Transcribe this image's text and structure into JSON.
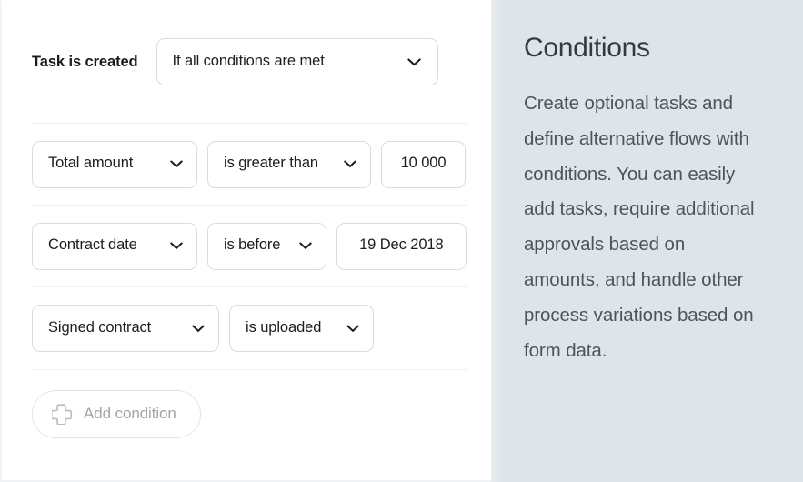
{
  "left_panel": {
    "trigger": {
      "label": "Task is created",
      "mode_select": {
        "value": "If all conditions are met",
        "icon": "chevron-down-icon"
      }
    },
    "conditions": [
      {
        "field": {
          "value": "Total amount",
          "icon": "chevron-down-icon"
        },
        "operator": {
          "value": "is greater than",
          "icon": "chevron-down-icon"
        },
        "value": {
          "value": "10 000"
        }
      },
      {
        "field": {
          "value": "Contract date",
          "icon": "chevron-down-icon"
        },
        "operator": {
          "value": "is before",
          "icon": "chevron-down-icon"
        },
        "value": {
          "value": "19 Dec 2018"
        }
      },
      {
        "field": {
          "value": "Signed contract",
          "icon": "chevron-down-icon"
        },
        "operator": {
          "value": "is uploaded",
          "icon": "chevron-down-icon"
        },
        "value": null
      }
    ],
    "add_button": {
      "label": "Add condition",
      "icon": "plus-icon"
    }
  },
  "right_panel": {
    "title": "Conditions",
    "body": "Create optional tasks and define alternative flows with conditions. You can easily add tasks, require additional approvals based on amounts, and handle other process variations based on form data."
  },
  "colors": {
    "panel_background": "#dde4ea",
    "canvas_background": "#ffffff",
    "border": "#d9dde0",
    "divider": "#eef1f3",
    "text_primary": "#1b1d1f",
    "text_heading": "#2f3c43",
    "text_body": "#4a565e",
    "text_muted": "#a0a6ab"
  }
}
